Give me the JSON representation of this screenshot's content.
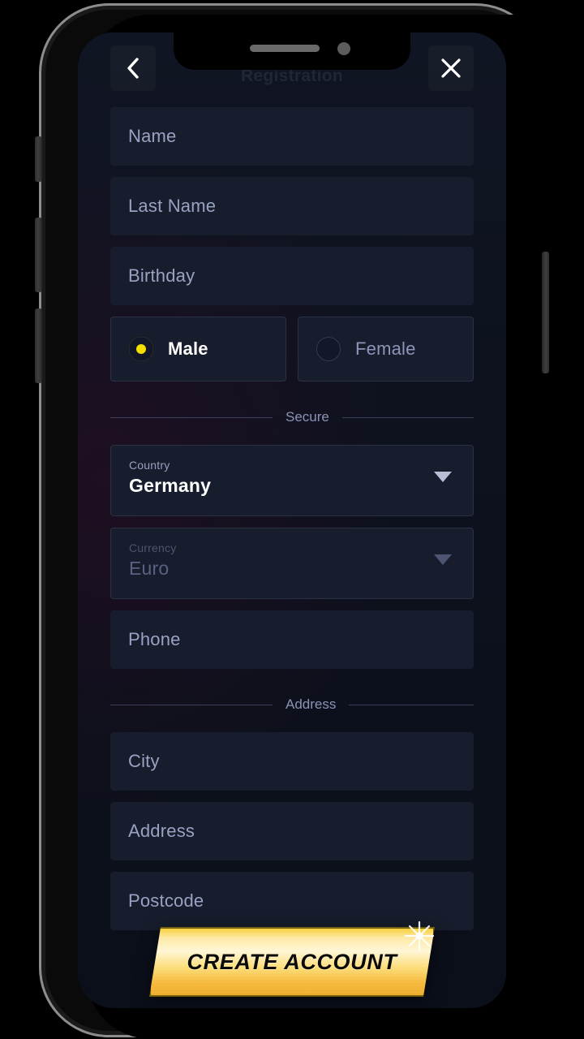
{
  "screen": {
    "background_color": "#0e1320",
    "accent_color": "#f3e000"
  },
  "header": {
    "title": "Registration",
    "back_icon": "chevron-left-icon",
    "close_icon": "close-icon"
  },
  "form": {
    "fields": [
      {
        "name": "name",
        "placeholder": "Name"
      },
      {
        "name": "lastname",
        "placeholder": "Last Name"
      },
      {
        "name": "birthday",
        "placeholder": "Birthday"
      }
    ],
    "gender": {
      "options": [
        {
          "label": "Male",
          "selected": true
        },
        {
          "label": "Female",
          "selected": false
        }
      ]
    },
    "secure_divider": "Secure",
    "country": {
      "caption": "Country",
      "value": "Germany",
      "caret_icon": "chevron-down-icon",
      "enabled": true
    },
    "currency": {
      "caption": "Currency",
      "value": "Euro",
      "caret_icon": "chevron-down-icon",
      "enabled": false
    },
    "phone": {
      "placeholder": "Phone"
    },
    "address_divider": "Address",
    "address_fields": [
      {
        "name": "city",
        "placeholder": "City"
      },
      {
        "name": "address",
        "placeholder": "Address"
      },
      {
        "name": "postcode",
        "placeholder": "Postcode"
      }
    ]
  },
  "cta": {
    "label": "CREATE ACCOUNT"
  }
}
